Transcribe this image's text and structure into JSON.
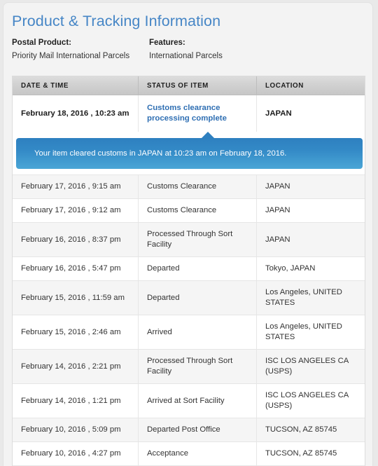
{
  "header": {
    "title": "Product & Tracking Information"
  },
  "product_meta": {
    "postal_product_label": "Postal Product:",
    "postal_product_value": "Priority Mail International Parcels",
    "features_label": "Features:",
    "features_value": "International Parcels"
  },
  "table": {
    "columns": [
      "DATE & TIME",
      "STATUS OF ITEM",
      "LOCATION"
    ],
    "current_event": {
      "datetime": "February 18, 2016 , 10:23 am",
      "status": "Customs clearance processing complete",
      "location": "JAPAN"
    },
    "callout": {
      "message": "Your item cleared customs in JAPAN at 10:23 am on February 18, 2016."
    },
    "rows": [
      {
        "datetime": "February 17, 2016 , 9:15 am",
        "status": "Customs Clearance",
        "location": "JAPAN"
      },
      {
        "datetime": "February 17, 2016 , 9:12 am",
        "status": "Customs Clearance",
        "location": "JAPAN"
      },
      {
        "datetime": "February 16, 2016 , 8:37 pm",
        "status": "Processed Through Sort Facility",
        "location": "JAPAN"
      },
      {
        "datetime": "February 16, 2016 , 5:47 pm",
        "status": "Departed",
        "location": "Tokyo, JAPAN"
      },
      {
        "datetime": "February 15, 2016 , 11:59 am",
        "status": "Departed",
        "location": "Los Angeles, UNITED STATES"
      },
      {
        "datetime": "February 15, 2016 , 2:46 am",
        "status": "Arrived",
        "location": "Los Angeles, UNITED STATES"
      },
      {
        "datetime": "February 14, 2016 , 2:21 pm",
        "status": "Processed Through Sort Facility",
        "location": "ISC LOS ANGELES CA (USPS)"
      },
      {
        "datetime": "February 14, 2016 , 1:21 pm",
        "status": "Arrived at Sort Facility",
        "location": "ISC LOS ANGELES CA (USPS)"
      },
      {
        "datetime": "February 10, 2016 , 5:09 pm",
        "status": "Departed Post Office",
        "location": "TUCSON, AZ 85745"
      },
      {
        "datetime": "February 10, 2016 , 4:27 pm",
        "status": "Acceptance",
        "location": "TUCSON, AZ 85745"
      }
    ]
  },
  "colors": {
    "title_blue": "#4686c6",
    "link_blue": "#2f6fb3",
    "callout_top": "#2e80c0",
    "callout_bottom": "#4aa6d6",
    "row_alt": "#f5f5f5",
    "page_bg": "#e9e9e9"
  }
}
